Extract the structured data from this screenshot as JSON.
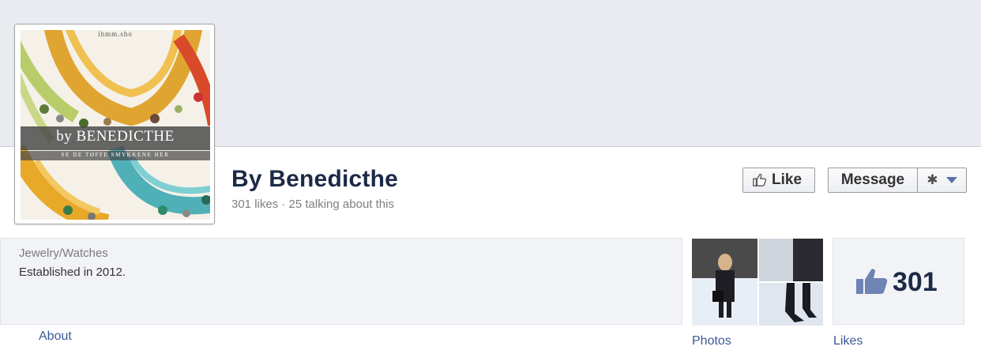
{
  "page": {
    "name": "By Benedicthe",
    "stats": "301 likes · 25 talking about this",
    "category": "Jewelry/Watches",
    "established": "Established in 2012."
  },
  "profile_image": {
    "brand_top": "ihmm.sho",
    "banner_title": "by BENEDICTHE",
    "banner_subtitle": "SE DE TØFFE SMYKKENE HER"
  },
  "buttons": {
    "like": "Like",
    "message": "Message",
    "like_icon": "thumbs-up-icon",
    "settings_icon": "gear-icon",
    "dropdown_icon": "caret-down-icon"
  },
  "tabs": {
    "about": "About",
    "photos": "Photos",
    "likes": "Likes"
  },
  "likes_count": "301",
  "colors": {
    "cover_bg": "#e9ebf0",
    "name_color": "#1c2a47",
    "link_color": "#3b5998",
    "panel_bg": "#f2f3f7"
  }
}
